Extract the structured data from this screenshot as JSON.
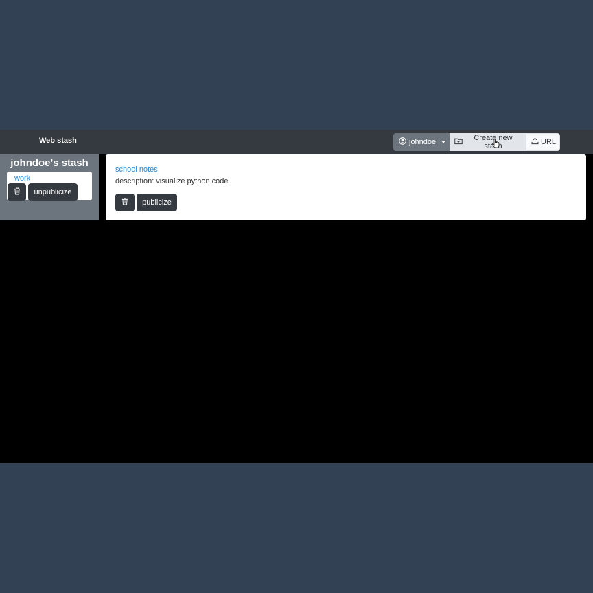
{
  "navbar": {
    "brand": "Web stash",
    "user_label": "johndoe",
    "create_label": "Create new stash",
    "url_label": "URL"
  },
  "sidebar": {
    "title": "johndoe's stash",
    "stash": {
      "name": "work",
      "action_label": "unpublicize"
    }
  },
  "main": {
    "stash": {
      "name": "school notes",
      "description": "description: visualize python code",
      "action_label": "publicize"
    }
  },
  "colors": {
    "page_background": "#324153",
    "navbar": "#343a40",
    "sidebar": "#6c757d",
    "link": "#2a8ad6",
    "dark_button": "#343a40"
  }
}
